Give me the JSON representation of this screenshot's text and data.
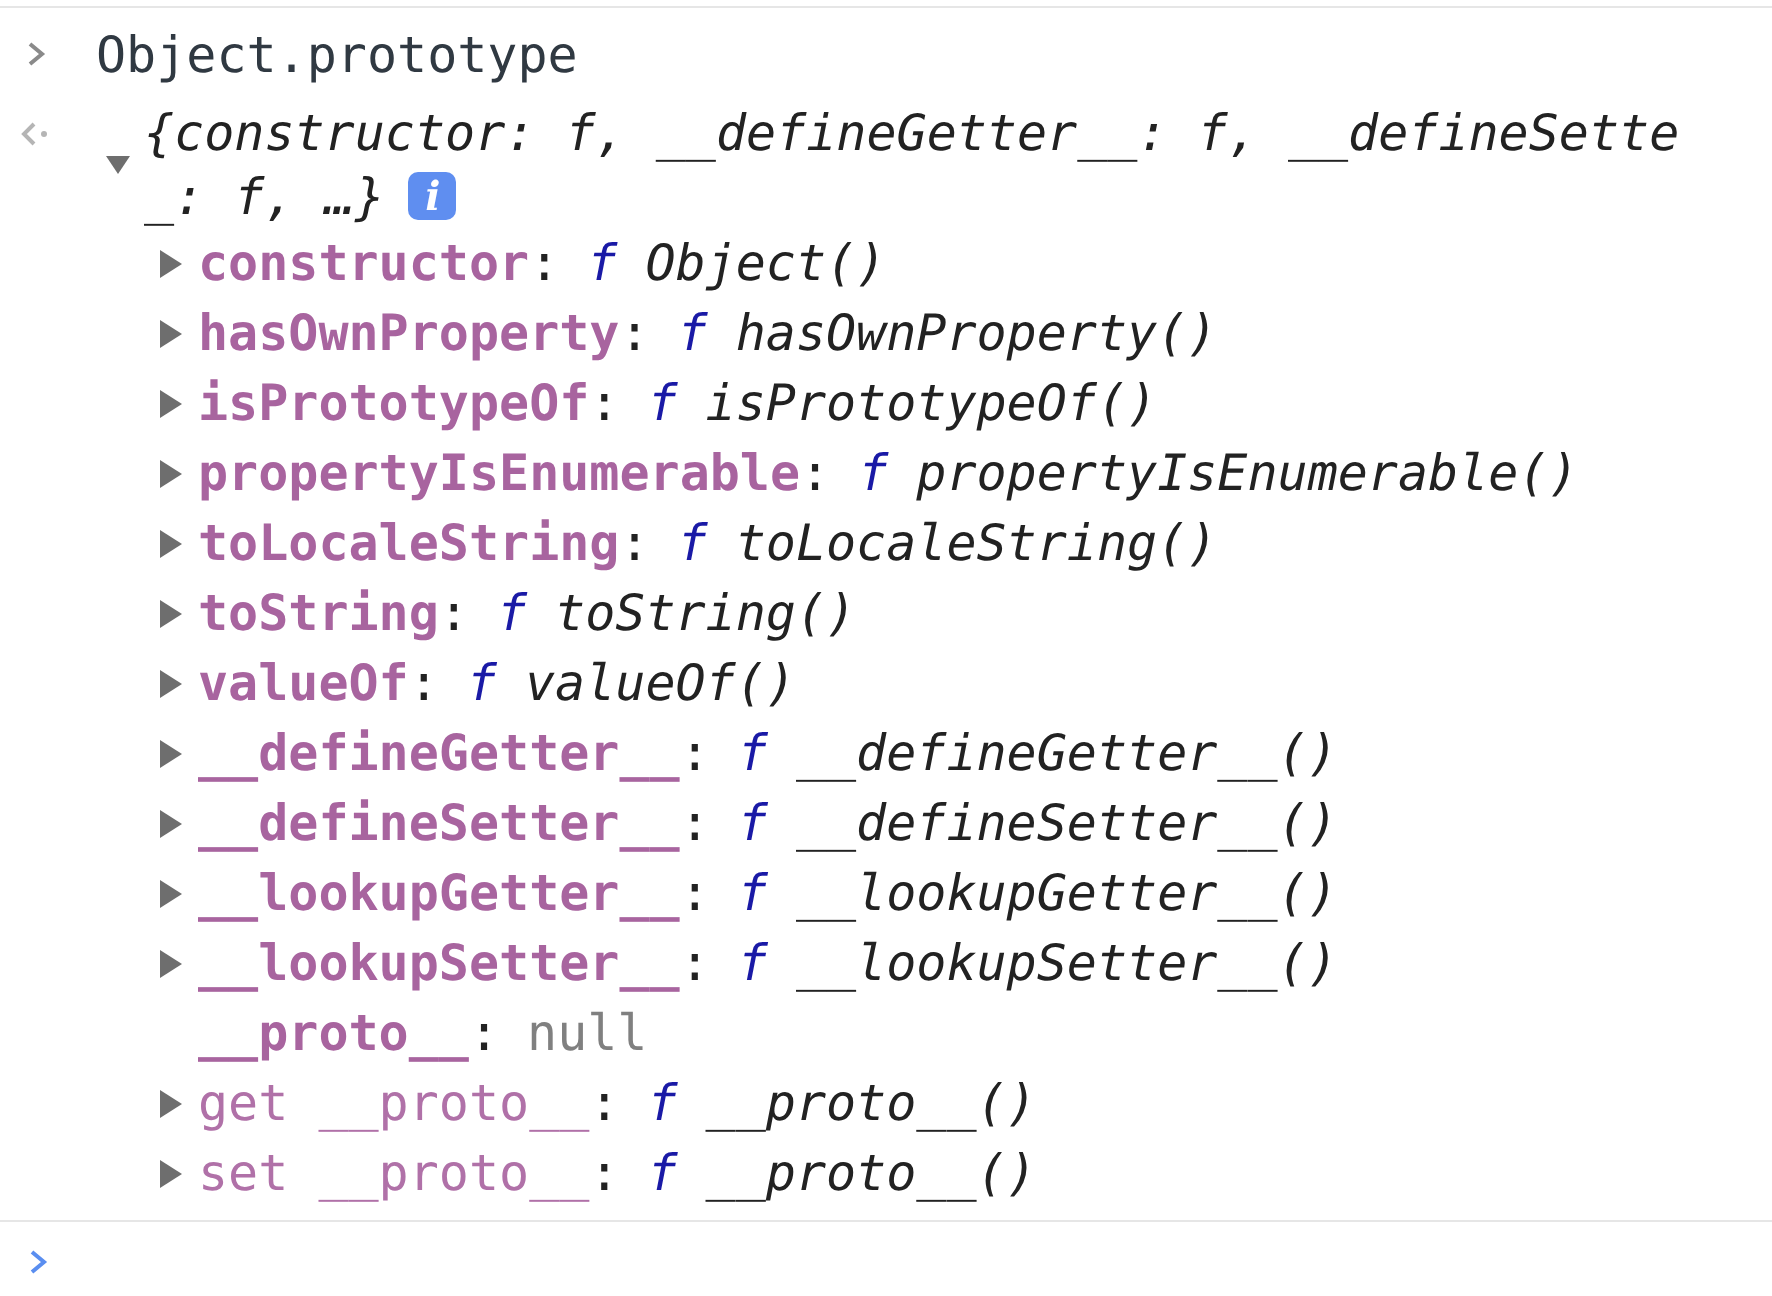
{
  "input": {
    "text": "Object.prototype"
  },
  "result": {
    "expanded": true,
    "summary_lines": [
      "{constructor: f, __defineGetter__: f, __defineSette",
      "_: f, …}"
    ],
    "info_badge": "i",
    "properties": [
      {
        "kind": "own",
        "name": "constructor",
        "colon": ":",
        "expandable": true,
        "prefix": "f",
        "value": "Object()"
      },
      {
        "kind": "own",
        "name": "hasOwnProperty",
        "colon": ":",
        "expandable": true,
        "prefix": "f",
        "value": "hasOwnProperty()"
      },
      {
        "kind": "own",
        "name": "isPrototypeOf",
        "colon": ":",
        "expandable": true,
        "prefix": "f",
        "value": "isPrototypeOf()"
      },
      {
        "kind": "own",
        "name": "propertyIsEnumerable",
        "colon": ":",
        "expandable": true,
        "prefix": "f",
        "value": "propertyIsEnumerable()"
      },
      {
        "kind": "own",
        "name": "toLocaleString",
        "colon": ":",
        "expandable": true,
        "prefix": "f",
        "value": "toLocaleString()"
      },
      {
        "kind": "own",
        "name": "toString",
        "colon": ":",
        "expandable": true,
        "prefix": "f",
        "value": "toString()"
      },
      {
        "kind": "own",
        "name": "valueOf",
        "colon": ":",
        "expandable": true,
        "prefix": "f",
        "value": "valueOf()"
      },
      {
        "kind": "own",
        "name": "__defineGetter__",
        "colon": ":",
        "expandable": true,
        "prefix": "f",
        "value": "__defineGetter__()"
      },
      {
        "kind": "own",
        "name": "__defineSetter__",
        "colon": ":",
        "expandable": true,
        "prefix": "f",
        "value": "__defineSetter__()"
      },
      {
        "kind": "own",
        "name": "__lookupGetter__",
        "colon": ":",
        "expandable": true,
        "prefix": "f",
        "value": "__lookupGetter__()"
      },
      {
        "kind": "own",
        "name": "__lookupSetter__",
        "colon": ":",
        "expandable": true,
        "prefix": "f",
        "value": "__lookupSetter__()"
      },
      {
        "kind": "own",
        "name": "__proto__",
        "colon": ":",
        "expandable": false,
        "value": "null"
      },
      {
        "kind": "accessor",
        "name": "get __proto__",
        "colon": ":",
        "expandable": true,
        "prefix": "f",
        "value": "__proto__()"
      },
      {
        "kind": "accessor",
        "name": "set __proto__",
        "colon": ":",
        "expandable": true,
        "prefix": "f",
        "value": "__proto__()"
      }
    ]
  }
}
